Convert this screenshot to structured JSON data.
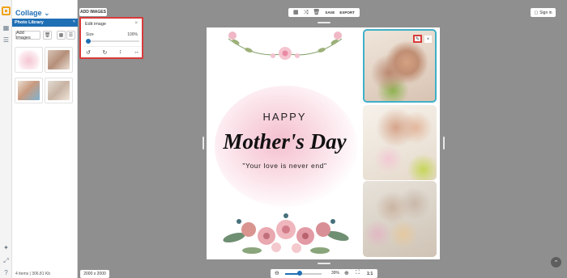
{
  "app": {
    "title": "Collage",
    "title_chevron": "⌄"
  },
  "rail": {
    "icons": [
      "grid-icon",
      "sliders-icon",
      "bulb-icon",
      "expand-icon",
      "help-icon"
    ]
  },
  "panel": {
    "library_title": "Photo Library",
    "close_label": "×",
    "add_button": "Add images",
    "thumbnails": [
      {
        "name": "card-thumbnail",
        "color": "#f4dde3"
      },
      {
        "name": "family-thumbnail-1",
        "color": "#c9b6a8"
      },
      {
        "name": "family-thumbnail-2",
        "color": "#e2c3b4"
      },
      {
        "name": "family-thumbnail-3",
        "color": "#d7cfc4"
      }
    ],
    "footer_info": "4 items | 306.81 Kb"
  },
  "topbar": {
    "add_images_tab": "ADD IMAGES",
    "save_label": "SAVE",
    "export_label": "EXPORT",
    "signin_label": "Sign in"
  },
  "edit_image": {
    "title": "Edit image",
    "close_label": "×",
    "size_label": "Size",
    "size_value": "100%",
    "size_fraction": 0.0,
    "ops": [
      "rotate-left",
      "rotate-right",
      "flip-vertical",
      "flip-horizontal"
    ]
  },
  "card": {
    "line1": "HAPPY",
    "line2": "Mother's Day",
    "quote": "\"Your love is never end\""
  },
  "photos": [
    {
      "name": "photo-mother-daughter-hug",
      "colors": [
        "#e9d9cd",
        "#c08e73",
        "#8db24f"
      ]
    },
    {
      "name": "photo-mother-child-card",
      "colors": [
        "#f1ece4",
        "#d6a48a",
        "#f2c9d4"
      ]
    },
    {
      "name": "photo-grandmother-family",
      "colors": [
        "#ddd7cd",
        "#c4b2a0",
        "#e5c8a0"
      ]
    }
  ],
  "bottombar": {
    "dimensions": "2000 x 2000",
    "zoom_value": "39%",
    "zoom_fraction": 0.39,
    "fit_label": "1:1"
  },
  "colors": {
    "accent": "#1f6fb5",
    "highlight": "#d83a3a",
    "selection": "#3fb0c8"
  }
}
